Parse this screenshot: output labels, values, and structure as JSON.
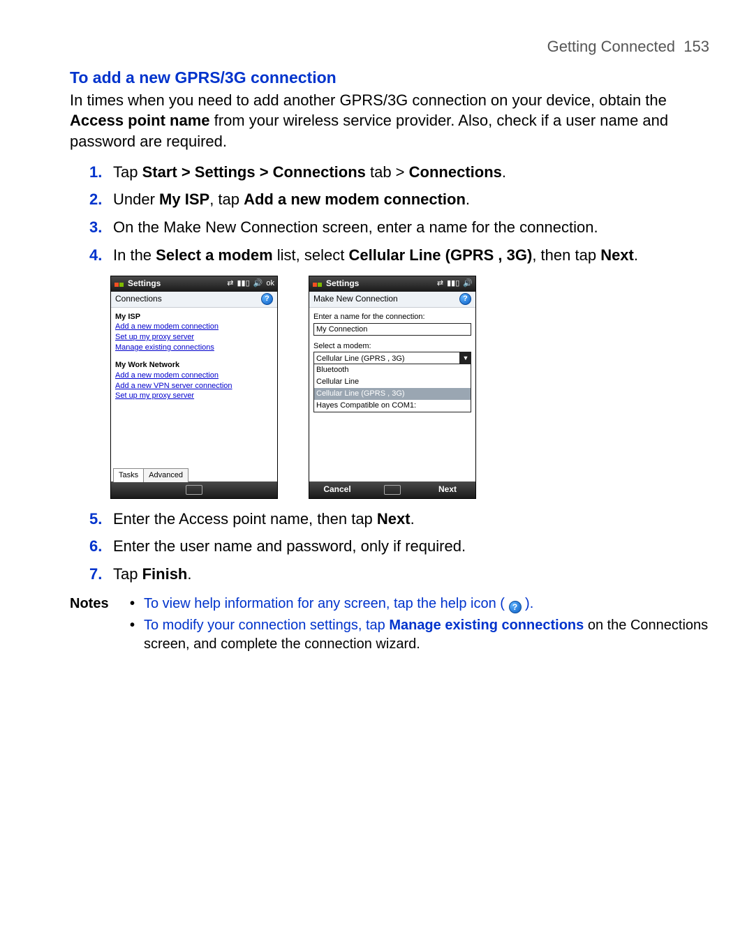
{
  "header": {
    "chapter": "Getting Connected",
    "page_number": "153"
  },
  "section_title": "To add a new GPRS/3G connection",
  "intro": {
    "line1_a": "In times when you need to add another GPRS/3G connection on your device, obtain the ",
    "bold1": "Access point name",
    "line1_b": " from your wireless service provider. Also, check if a user name and password are required."
  },
  "steps": {
    "s1": {
      "num": "1.",
      "a": "Tap ",
      "b": "Start > Settings > Connections",
      "c": " tab > ",
      "d": "Connections",
      "e": "."
    },
    "s2": {
      "num": "2.",
      "a": "Under ",
      "b": "My ISP",
      "c": ", tap ",
      "d": "Add a new modem connection",
      "e": "."
    },
    "s3": {
      "num": "3.",
      "a": "On the Make New Connection screen, enter a name for the connection."
    },
    "s4": {
      "num": "4.",
      "a": "In the ",
      "b": "Select a modem",
      "c": " list, select ",
      "d": "Cellular Line (GPRS , 3G)",
      "e": ", then tap ",
      "f": "Next",
      "g": "."
    },
    "s5": {
      "num": "5.",
      "a": "Enter the Access point name, then tap ",
      "b": "Next",
      "c": "."
    },
    "s6": {
      "num": "6.",
      "a": "Enter the user name and password, only if required."
    },
    "s7": {
      "num": "7.",
      "a": "Tap ",
      "b": "Finish",
      "c": "."
    }
  },
  "screen_left": {
    "title": "Settings",
    "status_ok": "ok",
    "subheader": "Connections",
    "isp_head": "My ISP",
    "isp_links": [
      "Add a new modem connection",
      "Set up my proxy server",
      "Manage existing connections"
    ],
    "work_head": "My Work Network",
    "work_links": [
      "Add a new modem connection",
      "Add a new VPN server connection",
      "Set up my proxy server"
    ],
    "tabs": [
      "Tasks",
      "Advanced"
    ]
  },
  "screen_right": {
    "title": "Settings",
    "subheader": "Make New Connection",
    "label_name": "Enter a name for the connection:",
    "value_name": "My Connection",
    "label_modem": "Select a modem:",
    "combo_value": "Cellular Line (GPRS , 3G)",
    "options": [
      "Bluetooth",
      "Cellular Line",
      "Cellular Line (GPRS , 3G)",
      "Hayes Compatible on COM1:"
    ],
    "selected_index": 2,
    "btn_left": "Cancel",
    "btn_right": "Next"
  },
  "notes": {
    "label": "Notes",
    "n1_a": "To view help information for any screen, tap the help icon ( ",
    "n1_b": " ).",
    "n2_a": "To modify your connection settings, tap ",
    "n2_bold": "Manage existing connections",
    "n2_b": " on the Connections screen, and complete the connection wizard."
  }
}
